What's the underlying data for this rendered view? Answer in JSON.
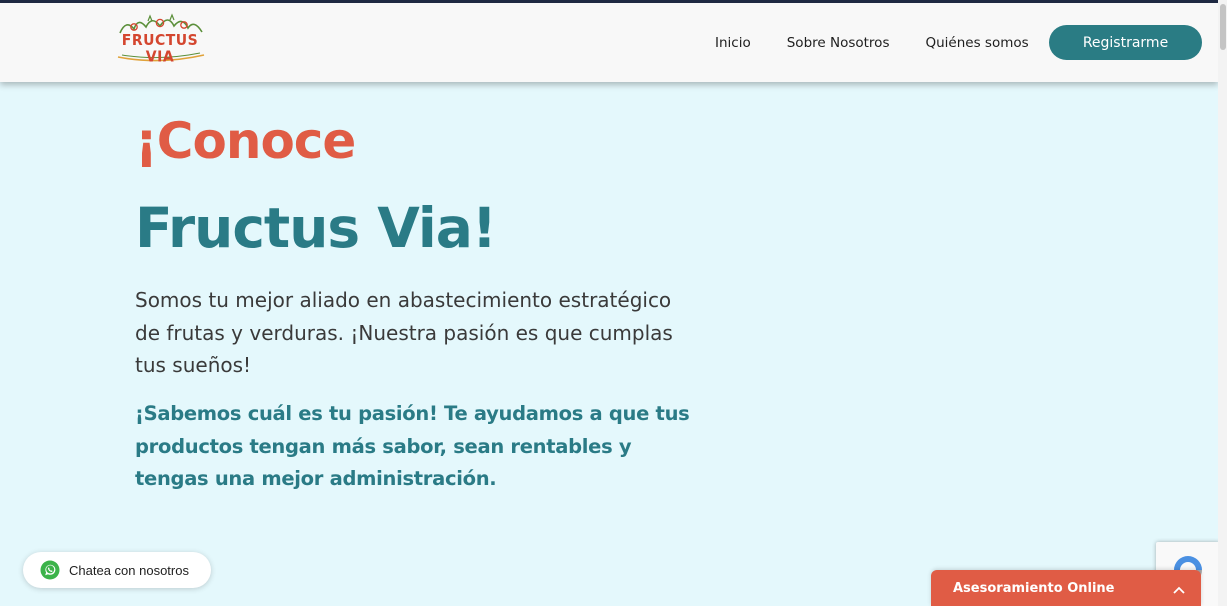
{
  "header": {
    "logo_text": "FRUCTUS VIA",
    "nav": [
      {
        "label": "Inicio"
      },
      {
        "label": "Sobre Nosotros"
      },
      {
        "label": "Quiénes somos"
      }
    ],
    "register_label": "Registrarme"
  },
  "hero": {
    "title_line1": "¡Conoce",
    "title_line2": "Fructus Via!",
    "description": "Somos tu mejor aliado en abastecimiento estratégico de frutas y verduras. ¡Nuestra pasión es que cumplas tus sueños!",
    "highlight": "¡Sabemos cuál es tu pasión! Te ayudamos a que tus productos tengan más sabor, sean rentables y tengas una mejor administración."
  },
  "whatsapp": {
    "label": "Chatea con nosotros",
    "icon": "whatsapp-icon"
  },
  "online_tab": {
    "label": "Asesoramiento Online",
    "icon": "chevron-up-icon"
  },
  "recaptcha": {
    "icon": "recaptcha-icon"
  },
  "colors": {
    "accent": "#e05c45",
    "brand": "#2a7b86",
    "background": "#e4f8fc"
  }
}
